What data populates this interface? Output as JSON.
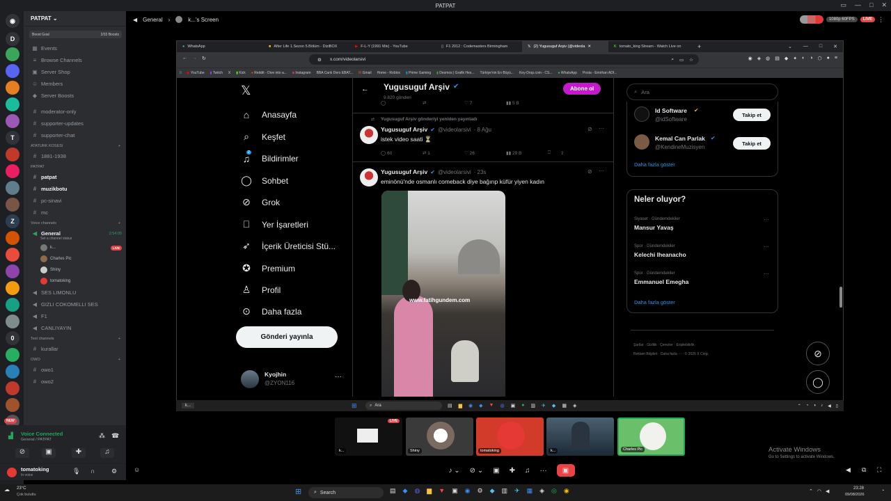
{
  "window": {
    "title": "PATPAT"
  },
  "server": {
    "name": "PATPAT",
    "boost_label": "Boost Goal",
    "boost_count": "2/33 Boosts"
  },
  "channels": {
    "top": [
      "Events",
      "Browse Channels",
      "Server Shop",
      "Members",
      "Server Boosts"
    ],
    "misc": [
      "moderator-only",
      "supporter-updates",
      "supporter-chat"
    ],
    "cat1": "ATATURK KOSESI",
    "cat1_items": [
      "1881-1938"
    ],
    "cat2": "PATPAT",
    "cat2_items": [
      "patpat",
      "muzikbotu",
      "pc-sinavi",
      "mc"
    ],
    "cat3": "Voice channels",
    "general": {
      "name": "General",
      "timer": "2:54:05",
      "status": "Set a channel status",
      "live": "LIVE"
    },
    "voice_users": [
      "k...",
      "Charles Pic",
      "Shiny",
      "tomatoking"
    ],
    "voice_more": [
      "SES LIMONLU",
      "GIZLI COKOMELLI SES",
      "F1",
      "CANLIYAYIN"
    ],
    "cat4": "Text channels",
    "cat4_items": [
      "kurallar"
    ],
    "cat5": "OWO",
    "cat5_items": [
      "owo1",
      "owo2"
    ]
  },
  "voice_panel": {
    "title": "Voice Connected",
    "subtitle": "General / PATPAT",
    "new_badge": "NEW"
  },
  "user_panel": {
    "name": "tomatoking",
    "status": "In voice"
  },
  "stream_header": {
    "channel": "General",
    "stream": "k...'s Screen",
    "quality": "1080p 60FPS",
    "live": "LIVE"
  },
  "browser": {
    "tabs": [
      "WhatsApp",
      "After Life 1.Sezon 5.Bölüm - DiziBOX",
      "F-L-Y (1991 Mix) - YouTube",
      "F1 2012 : Codemasters Birmingham",
      "(2) Yugusuguf Arşiv (@videola",
      "tomato_king Stream - Watch Live on"
    ],
    "url": "x.com/videolarsivi",
    "bookmarks": [
      "YouTube",
      "Twitch",
      "X",
      "Kick",
      "Reddit - Dive into a...",
      "Instagram",
      "BBA Canlı Ders EBAT...",
      "Gmail",
      "Home - Roblox",
      "Prime Gaming",
      "Desmos | Grafik Hes...",
      "Türkiye'nin En Büyü...",
      "Key-Drop.com - CS...",
      "WhatsApp",
      "Posta - Emirhan ADI..."
    ]
  },
  "x": {
    "nav": [
      "Anasayfa",
      "Keşfet",
      "Bildirimler",
      "Sohbet",
      "Grok",
      "Yer İşaretleri",
      "İçerik Üreticisi Stü...",
      "Premium",
      "Profil",
      "Daha fazla"
    ],
    "notif_count": "2",
    "post_button": "Gönderi yayınla",
    "account_name": "Kyojhin",
    "account_handle": "@ZYON116",
    "header_name": "Yugusuguf Arşiv",
    "header_sub": "9.820 gönderi",
    "subscribe": "Abone ol",
    "top_metrics": [
      "",
      "",
      "7",
      "5 B"
    ],
    "retweet_label": "Yugusuguf Arşiv gönderiyi yeniden yayınladı",
    "tweet1": {
      "name": "Yugusuguf Arşiv",
      "handle": "@videolarsivi",
      "time": "· 8 Ağu",
      "text": "istek video saati ⏳",
      "metrics": [
        "60",
        "1",
        "26",
        "29 B"
      ]
    },
    "tweet2": {
      "name": "Yugusuguf Arşiv",
      "handle": "@videolarsivi",
      "time": "· 23s",
      "text": "eminönü'nde osmanlı comeback diye bağırıp küfür yiyen kadın",
      "watermark": "www.fatihgundem.com"
    },
    "search_placeholder": "Ara",
    "who_to_follow": [
      {
        "name": "Id Software",
        "handle": "@idSoftware",
        "button": "Takip et"
      },
      {
        "name": "Kemal Can Parlak",
        "handle": "@KendineMuzisyen",
        "button": "Takip et"
      }
    ],
    "show_more": "Daha fazla göster",
    "trends_title": "Neler oluyor?",
    "trends": [
      {
        "meta": "Siyaset · Gündemdekiler",
        "name": "Mansur Yavaş"
      },
      {
        "meta": "Spor · Gündemdekiler",
        "name": "Kelechi Iheanacho"
      },
      {
        "meta": "Spor · Gündemdekiler",
        "name": "Emmanuel Emegha"
      }
    ],
    "footer": [
      "Şartlar",
      "Gizlilik",
      "Çerezler",
      "Erişilebilirlik",
      "Reklam Bilgileri",
      "Daha fazla ···",
      "© 2026 X Corp."
    ]
  },
  "inner_taskbar": {
    "search": "Ara",
    "item": "k..."
  },
  "tiles": [
    "k...",
    "Shiny",
    "tomatoking",
    "k...",
    "Charles Pic"
  ],
  "tile_live": "LIVE",
  "activate": {
    "title": "Activate Windows",
    "sub": "Go to Settings to activate Windows."
  },
  "taskbar": {
    "weather": "23°C",
    "weather_sub": "Çok bulutlu",
    "search": "Search",
    "time": "23:28",
    "date": "09/08/2026"
  },
  "colors": {
    "accent": "#1d9bf0",
    "live": "#ed4245",
    "voice": "#23a55a",
    "subscribe": "#c41acb"
  }
}
